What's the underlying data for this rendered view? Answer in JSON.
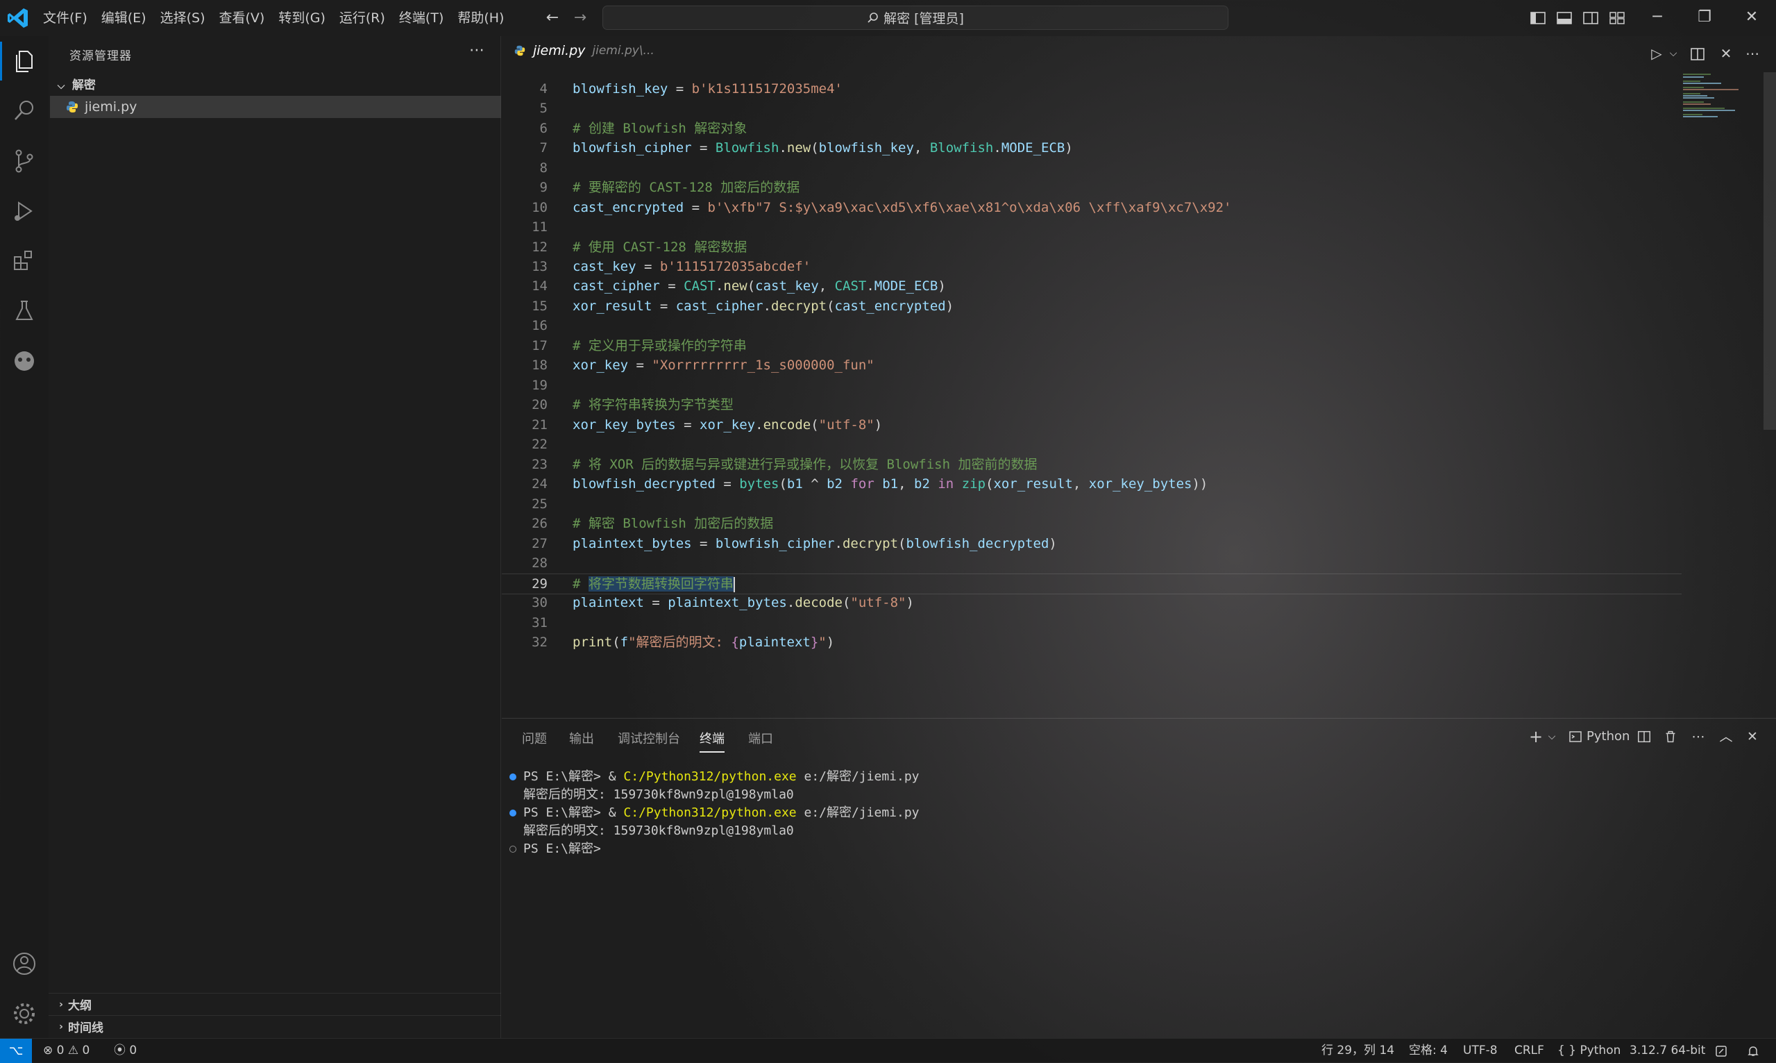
{
  "window": {
    "search_text": "解密 [管理员]"
  },
  "menu": [
    "文件(F)",
    "编辑(E)",
    "选择(S)",
    "查看(V)",
    "转到(G)",
    "运行(R)",
    "终端(T)",
    "帮助(H)"
  ],
  "sidebar": {
    "title": "资源管理器",
    "folder": "解密",
    "file": "jiemi.py",
    "sections": [
      "大纲",
      "时间线"
    ]
  },
  "editor": {
    "tab_name": "jiemi.py",
    "tab_path": "jiemi.py\\...",
    "line_numbers": [
      "4",
      "5",
      "6",
      "7",
      "8",
      "9",
      "10",
      "11",
      "12",
      "13",
      "14",
      "15",
      "16",
      "17",
      "18",
      "19",
      "20",
      "21",
      "22",
      "23",
      "24",
      "25",
      "26",
      "27",
      "28",
      "29",
      "30",
      "31",
      "32"
    ],
    "current_line": "29",
    "code": {
      "l4_var": "blowfish_key",
      "l4_val": "b'k1s1115172035me4'",
      "l6": "# 创建 Blowfish 解密对象",
      "l7_var": "blowfish_cipher",
      "l7_cls": "Blowfish",
      "l7_fn": "new",
      "l7_arg": "blowfish_key",
      "l7_cls2": "Blowfish",
      "l7_const": "MODE_ECB",
      "l9": "# 要解密的 CAST-128 加密后的数据",
      "l10_var": "cast_encrypted",
      "l10_val": "b'\\xfb\"7 S:$y\\xa9\\xac\\xd5\\xf6\\xae\\x81^o\\xda\\x06 \\xff\\xaf9\\xc7\\x92'",
      "l12": "# 使用 CAST-128 解密数据",
      "l13_var": "cast_key",
      "l13_val": "b'1115172035abcdef'",
      "l14_var": "cast_cipher",
      "l14_cls": "CAST",
      "l14_fn": "new",
      "l14_arg": "cast_key",
      "l14_cls2": "CAST",
      "l14_const": "MODE_ECB",
      "l15_var": "xor_result",
      "l15_obj": "cast_cipher",
      "l15_fn": "decrypt",
      "l15_arg": "cast_encrypted",
      "l17": "# 定义用于异或操作的字符串",
      "l18_var": "xor_key",
      "l18_val": "\"Xorrrrrrrrr_1s_s000000_fun\"",
      "l20": "# 将字符串转换为字节类型",
      "l21_var": "xor_key_bytes",
      "l21_obj": "xor_key",
      "l21_fn": "encode",
      "l21_arg": "\"utf-8\"",
      "l23": "# 将 XOR 后的数据与异或键进行异或操作，以恢复 Blowfish 加密前的数据",
      "l24_var": "blowfish_decrypted",
      "l24_fn": "bytes",
      "l24_b1": "b1",
      "l24_b2": "b2",
      "l24_for": "for",
      "l24_b1b": "b1",
      "l24_b2b": "b2",
      "l24_in": "in",
      "l24_zip": "zip",
      "l24_a1": "xor_result",
      "l24_a2": "xor_key_bytes",
      "l26": "# 解密 Blowfish 加密后的数据",
      "l27_var": "plaintext_bytes",
      "l27_obj": "blowfish_cipher",
      "l27_fn": "decrypt",
      "l27_arg": "blowfish_decrypted",
      "l29_hash": "# ",
      "l29_sel": "将字节数据转换回字符串",
      "l30_var": "plaintext",
      "l30_obj": "plaintext_bytes",
      "l30_fn": "decode",
      "l30_arg": "\"utf-8\"",
      "l32_fn": "print",
      "l32_f": "f",
      "l32_s1": "\"解密后的明文: ",
      "l32_expr": "plaintext",
      "l32_s2": "\""
    }
  },
  "panel": {
    "tabs": [
      "问题",
      "输出",
      "调试控制台",
      "终端",
      "端口"
    ],
    "active_tab": "终端",
    "terminal_profile": "Python",
    "terminal": {
      "prompt": "PS E:\\解密> ",
      "amp": "& ",
      "exe": "C:/Python312/python.exe",
      "script": " e:/解密/jiemi.py",
      "output": "解密后的明文: 159730kf8wn9zpl@198ymla0",
      "last_prompt": "PS E:\\解密>"
    }
  },
  "statusbar": {
    "errors": "0",
    "warnings": "0",
    "ports": "0",
    "position": "行 29，列 14",
    "spaces": "空格: 4",
    "encoding": "UTF-8",
    "eol": "CRLF",
    "language": "Python",
    "interpreter": "3.12.7 64-bit"
  },
  "colors": {
    "accent": "#0078d4",
    "comment": "#6a9955",
    "string": "#ce9178",
    "variable": "#9cdcfe",
    "class": "#4ec9b0",
    "function": "#dcdcaa",
    "keyword": "#c586c0"
  }
}
